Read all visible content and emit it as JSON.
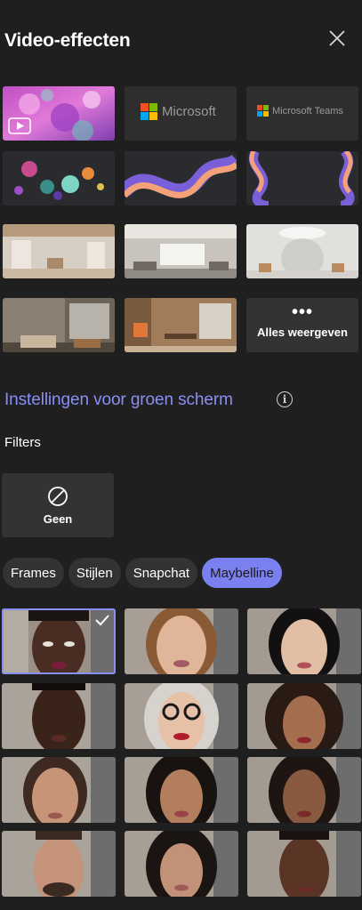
{
  "header": {
    "title": "Video-effecten",
    "close_icon": "close-icon"
  },
  "backgrounds": {
    "brand_tile_1": "Microsoft",
    "brand_tile_2": "Microsoft Teams",
    "show_all_label": "Alles weergeven",
    "show_all_icon": "more-horizontal-icon"
  },
  "green_screen": {
    "label": "Instellingen voor groen scherm",
    "info_icon": "info-icon"
  },
  "filters": {
    "title": "Filters",
    "none_label": "Geen",
    "none_icon": "prohibited-icon"
  },
  "tabs": [
    {
      "label": "Frames",
      "active": false
    },
    {
      "label": "Stijlen",
      "active": false
    },
    {
      "label": "Snapchat",
      "active": false
    },
    {
      "label": "Maybelline",
      "active": true
    }
  ],
  "colors": {
    "background": "#1f1f1f",
    "tile": "#333333",
    "accent": "#8b8ff5",
    "active_tab": "#7b80f0"
  }
}
